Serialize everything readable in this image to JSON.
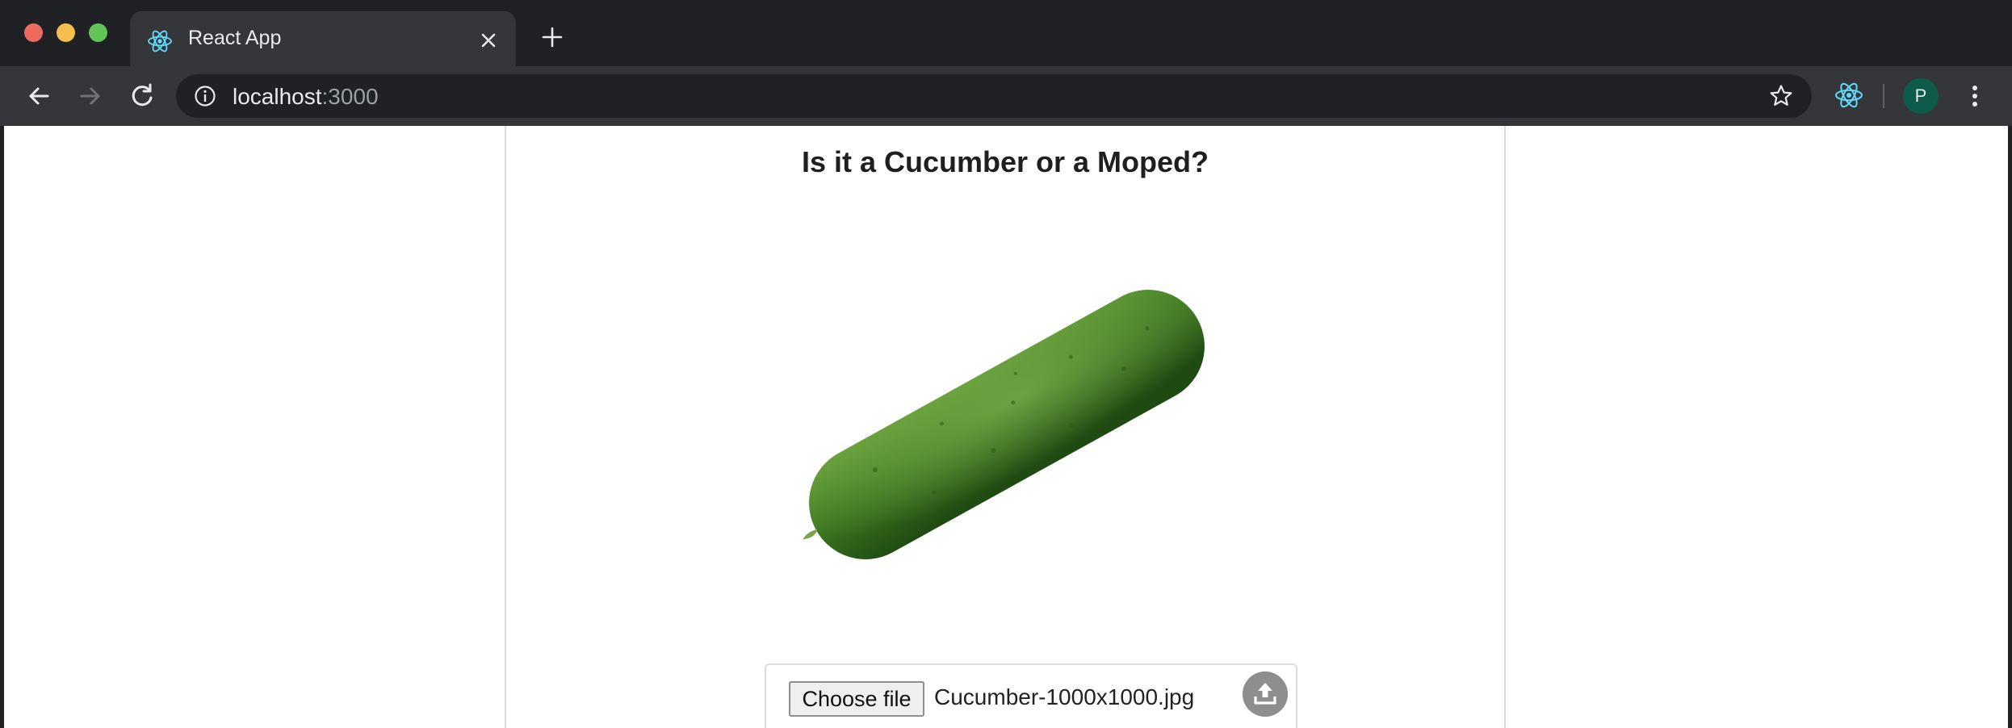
{
  "browser": {
    "tab": {
      "title": "React App",
      "favicon": "react-logo-icon"
    },
    "address": {
      "host": "localhost",
      "port": ":3000"
    },
    "profile_initial": "P"
  },
  "page": {
    "heading": "Is it a Cucumber or a Moped?",
    "image_subject": "cucumber",
    "upload": {
      "button_label": "Choose file",
      "file_name": "Cucumber-1000x1000.jpg"
    }
  },
  "colors": {
    "window_bg": "#202124",
    "toolbar_bg": "#35363a",
    "avatar_bg": "#0d5c4b",
    "react_blue": "#61dafb"
  }
}
